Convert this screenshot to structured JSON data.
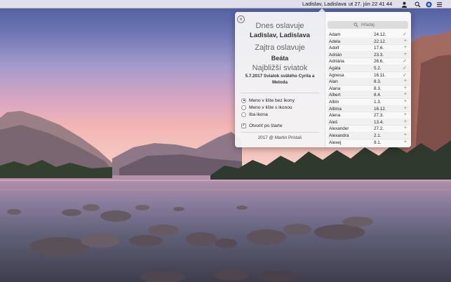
{
  "menubar": {
    "names": "Ladislav, Ladislava",
    "clock": "ut 27. jún  22 41 44",
    "icons": [
      "user-icon",
      "search-icon",
      "siri-icon",
      "list-icon"
    ]
  },
  "popover": {
    "close_icon": "×",
    "today_label": "Dnes oslavuje",
    "today_names": "Ladislav, Ladislava",
    "tomorrow_label": "Zajtra oslavuje",
    "tomorrow_name": "Beáta",
    "holiday_label": "Najbližší sviatok",
    "holiday_text": "5.7.2017 Sviatok svätého Cyrila a Metoda",
    "options": [
      {
        "label": "Meno v lište bez ikony",
        "selected": true
      },
      {
        "label": "Meno v lište s ikonou",
        "selected": false
      },
      {
        "label": "Iba ikona",
        "selected": false
      }
    ],
    "open_at_start": {
      "label": "Otvoriť po štarte",
      "checked": true,
      "mark": "✓"
    },
    "footer": "2017 @ Martin Pristaš",
    "search_placeholder": "Hľadaj",
    "names": [
      {
        "name": "Adam",
        "date": "24.12.",
        "mark": "✓"
      },
      {
        "name": "Adela",
        "date": "22.12.",
        "mark": "+"
      },
      {
        "name": "Adolf",
        "date": "17.6.",
        "mark": "+"
      },
      {
        "name": "Adrián",
        "date": "23.3.",
        "mark": "+"
      },
      {
        "name": "Adriána",
        "date": "26.6.",
        "mark": "✓"
      },
      {
        "name": "Agáta",
        "date": "5.2.",
        "mark": "✓"
      },
      {
        "name": "Agnesa",
        "date": "16.11.",
        "mark": "✓"
      },
      {
        "name": "Alan",
        "date": "8.3.",
        "mark": "+"
      },
      {
        "name": "Alana",
        "date": "8.3.",
        "mark": "+"
      },
      {
        "name": "Albert",
        "date": "8.4.",
        "mark": "+"
      },
      {
        "name": "Albín",
        "date": "1.3.",
        "mark": "+"
      },
      {
        "name": "Albína",
        "date": "16.12.",
        "mark": "+"
      },
      {
        "name": "Alena",
        "date": "27.3.",
        "mark": "+"
      },
      {
        "name": "Aleš",
        "date": "13.4.",
        "mark": "+"
      },
      {
        "name": "Alexander",
        "date": "27.2.",
        "mark": "+"
      },
      {
        "name": "Alexandra",
        "date": "2.1.",
        "mark": "+"
      },
      {
        "name": "Alexej",
        "date": "9.1.",
        "mark": "+"
      }
    ]
  }
}
